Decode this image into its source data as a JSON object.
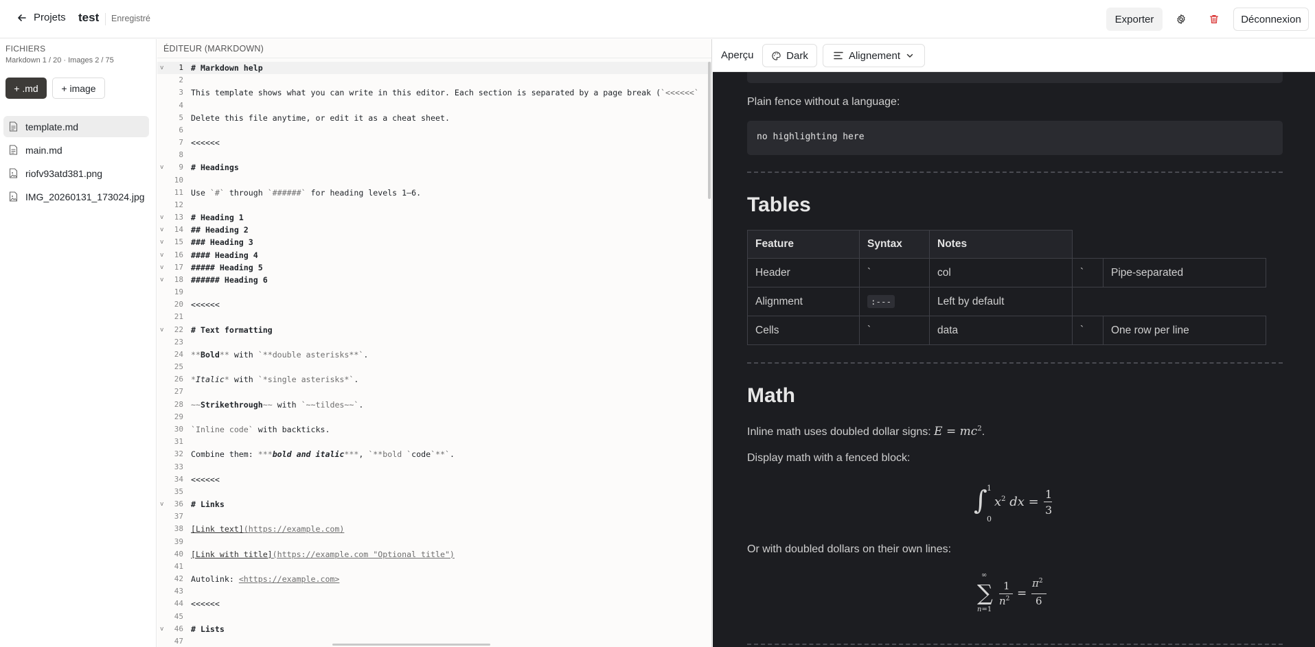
{
  "topbar": {
    "back_label": "Projets",
    "project_name": "test",
    "save_status": "Enregistré",
    "export_label": "Exporter",
    "logout_label": "Déconnexion"
  },
  "sidebar": {
    "title": "FICHIERS",
    "stats": "Markdown 1 / 20 · Images 2 / 75",
    "add_md_label": "+ .md",
    "add_image_label": "+ image",
    "files": [
      {
        "name": "template.md",
        "type": "md",
        "active": true
      },
      {
        "name": "main.md",
        "type": "md",
        "active": false
      },
      {
        "name": "riofv93atd381.png",
        "type": "image",
        "active": false
      },
      {
        "name": "IMG_20260131_173024.jpg",
        "type": "image",
        "active": false
      }
    ]
  },
  "editor": {
    "title": "ÉDITEUR (MARKDOWN)",
    "lines": [
      "# Markdown help",
      "",
      "This template shows what you can write in this editor. Each section is separated by a page break (`<<<<<<`",
      "",
      "Delete this file anytime, or edit it as a cheat sheet.",
      "",
      "<<<<<<",
      "",
      "# Headings",
      "",
      "Use `#` through `######` for heading levels 1–6.",
      "",
      "# Heading 1",
      "## Heading 2",
      "### Heading 3",
      "#### Heading 4",
      "##### Heading 5",
      "###### Heading 6",
      "",
      "<<<<<<",
      "",
      "# Text formatting",
      "",
      "**Bold** with `**double asterisks**`.",
      "",
      "*Italic* with `*single asterisks*`.",
      "",
      "~~Strikethrough~~ with `~~tildes~~`.",
      "",
      "`Inline code` with backticks.",
      "",
      "Combine them: ***bold and italic***, `**bold `code`**`.",
      "",
      "<<<<<<",
      "",
      "# Links",
      "",
      "[Link text](https://example.com)",
      "",
      "[Link with title](https://example.com \"Optional title\")",
      "",
      "Autolink: <https://example.com>",
      "",
      "<<<<<<",
      "",
      "# Lists",
      ""
    ]
  },
  "preview": {
    "label": "Aperçu",
    "theme_label": "Dark",
    "align_label": "Alignement",
    "plain_fence_text": "Plain fence without a language:",
    "plain_fence_code": "no highlighting here",
    "tables_heading": "Tables",
    "table": {
      "headers": [
        "Feature",
        "Syntax",
        "Notes"
      ],
      "rows": [
        [
          "Header",
          "`",
          "col",
          "`",
          "Pipe-separated"
        ],
        [
          "Alignment",
          ":---",
          "Left by default"
        ],
        [
          "Cells",
          "`",
          "data",
          "`",
          "One row per line"
        ]
      ]
    },
    "math_heading": "Math",
    "math_inline_text": "Inline math uses doubled dollar signs:",
    "math_display_text": "Display math with a fenced block:",
    "math_or_text": "Or with doubled dollars on their own lines:"
  }
}
